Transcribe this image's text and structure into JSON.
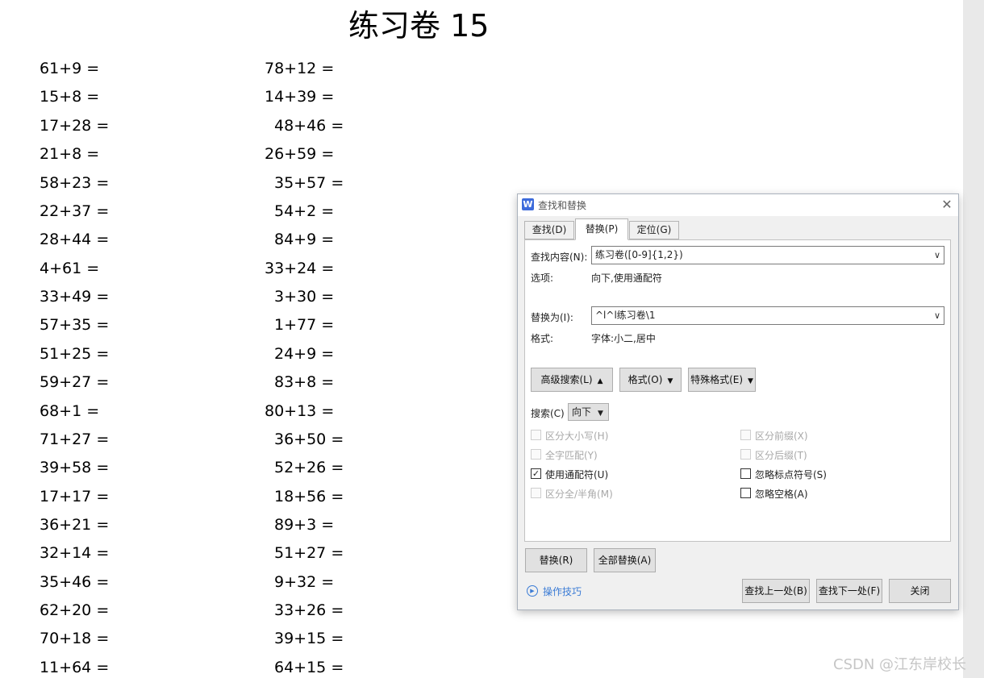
{
  "document": {
    "title": "练习卷 15",
    "left_column": [
      "61+9 =",
      "15+8 =",
      "17+28 =",
      "21+8 =",
      "58+23 =",
      "22+37 =",
      "28+44 =",
      "4+61 =",
      "33+49 =",
      "57+35 =",
      "51+25 =",
      "59+27 =",
      "68+1 =",
      "71+27 =",
      "39+58 =",
      "17+17 =",
      "36+21 =",
      "32+14 =",
      "35+46 =",
      "62+20 =",
      "70+18 =",
      "11+64 ="
    ],
    "right_column": [
      "78+12 =",
      "14+39 =",
      "48+46 =",
      "26+59 =",
      "35+57 =",
      "54+2 =",
      "84+9 =",
      "33+24 =",
      "3+30 =",
      "1+77 =",
      "24+9 =",
      "83+8 =",
      "80+13 =",
      "36+50 =",
      "52+26 =",
      "18+56 =",
      "89+3 =",
      "51+27 =",
      "9+32 =",
      "33+26 =",
      "39+15 =",
      "64+15 ="
    ]
  },
  "watermark": "CSDN @江东岸校长",
  "dialog": {
    "app_icon_letter": "W",
    "title": "查找和替换",
    "close_glyph": "✕",
    "tabs": [
      {
        "label": "查找(D)",
        "active": false
      },
      {
        "label": "替换(P)",
        "active": true
      },
      {
        "label": "定位(G)",
        "active": false
      }
    ],
    "find": {
      "label": "查找内容(N):",
      "value": "练习卷([0-9]{1,2})"
    },
    "options": {
      "label": "选项:",
      "value": "向下,使用通配符"
    },
    "replace": {
      "label": "替换为(I):",
      "value": "^l^l练习卷\\1"
    },
    "format": {
      "label": "格式:",
      "value": "字体:小二,居中"
    },
    "buttons": {
      "advanced": "高级搜索(L)",
      "format": "格式(O)",
      "special": "特殊格式(E)",
      "replace": "替换(R)",
      "replace_all": "全部替换(A)",
      "find_prev": "查找上一处(B)",
      "find_next": "查找下一处(F)",
      "close": "关闭"
    },
    "search": {
      "label": "搜索(C)",
      "value": "向下"
    },
    "checkboxes": {
      "match_case": {
        "label": "区分大小写(H)",
        "checked": false,
        "enabled": false
      },
      "whole_word": {
        "label": "全字匹配(Y)",
        "checked": false,
        "enabled": false
      },
      "use_wildcards": {
        "label": "使用通配符(U)",
        "checked": true,
        "enabled": true
      },
      "match_width": {
        "label": "区分全/半角(M)",
        "checked": false,
        "enabled": false
      },
      "match_prefix": {
        "label": "区分前缀(X)",
        "checked": false,
        "enabled": false
      },
      "match_suffix": {
        "label": "区分后缀(T)",
        "checked": false,
        "enabled": false
      },
      "ignore_punct": {
        "label": "忽略标点符号(S)",
        "checked": false,
        "enabled": true
      },
      "ignore_space": {
        "label": "忽略空格(A)",
        "checked": false,
        "enabled": true
      }
    },
    "tips_link": "操作技巧",
    "check_glyph": "✓",
    "up_arrow_glyph": "▲",
    "down_caret_glyph": "▼",
    "combo_arrow_glyph": "∨"
  }
}
